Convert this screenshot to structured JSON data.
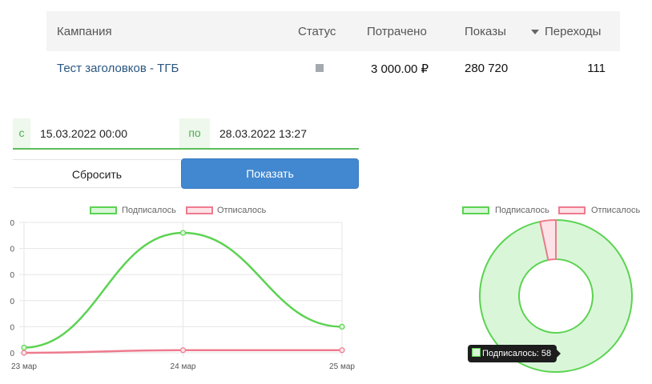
{
  "table": {
    "headers": {
      "campaign": "Кампания",
      "status": "Статус",
      "spent": "Потрачено",
      "impressions": "Показы",
      "clicks": "Переходы"
    },
    "rows": [
      {
        "campaign": "Тест заголовков - ТГБ",
        "spent": "3 000.00 ₽",
        "impressions": "280 720",
        "clicks": "111"
      }
    ]
  },
  "filter": {
    "from_label": "с",
    "from_value": "15.03.2022 00:00",
    "to_label": "по",
    "to_value": "28.03.2022 13:27",
    "reset_label": "Сбросить",
    "show_label": "Показать"
  },
  "colors": {
    "subscribed": "#5cd352",
    "subscribed_fill": "#d9f7d8",
    "unsubscribed": "#ee7b8e",
    "unsubscribed_fill": "#fde3e7",
    "accent": "#4288d0",
    "status": "#a3a9ae"
  },
  "chart_data": [
    {
      "type": "line",
      "x": [
        "23 мар",
        "24 мар",
        "25 мар"
      ],
      "series": [
        {
          "name": "Подписалось",
          "values": [
            2,
            46,
            10
          ]
        },
        {
          "name": "Отписалось",
          "values": [
            0,
            1,
            1
          ]
        }
      ],
      "ylim": [
        0,
        50
      ],
      "y_tick_labels": [
        "0",
        "0",
        "0",
        "0",
        "0",
        "0"
      ],
      "grid": true,
      "legend": "top"
    },
    {
      "type": "pie",
      "donut": true,
      "categories": [
        "Подписалось",
        "Отписалось"
      ],
      "values": [
        58,
        2
      ],
      "tooltip": "Подписалось: 58",
      "legend": "top"
    }
  ]
}
